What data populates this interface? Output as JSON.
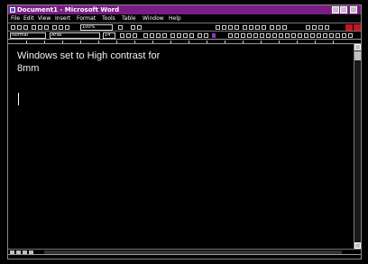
{
  "window": {
    "title": "Document1 - Microsoft Word"
  },
  "menubar": {
    "items": [
      "File",
      "Edit",
      "View",
      "Insert",
      "Format",
      "Tools",
      "Table",
      "Window",
      "Help"
    ]
  },
  "toolbar": {
    "zoom_value": "100%",
    "style_value": "Normal",
    "font_value": "Arial",
    "size_value": "14"
  },
  "document": {
    "line1": "Windows set to High contrast for",
    "line2": "8mm"
  },
  "colors": {
    "title_bar": "#7a1e86",
    "background": "#000000",
    "text": "#ffffff",
    "toolbar_highlight": "#c8151d"
  },
  "icons": [
    "app-icon",
    "minimize-icon",
    "maximize-icon",
    "close-icon",
    "scroll-up-icon",
    "scroll-down-icon"
  ]
}
